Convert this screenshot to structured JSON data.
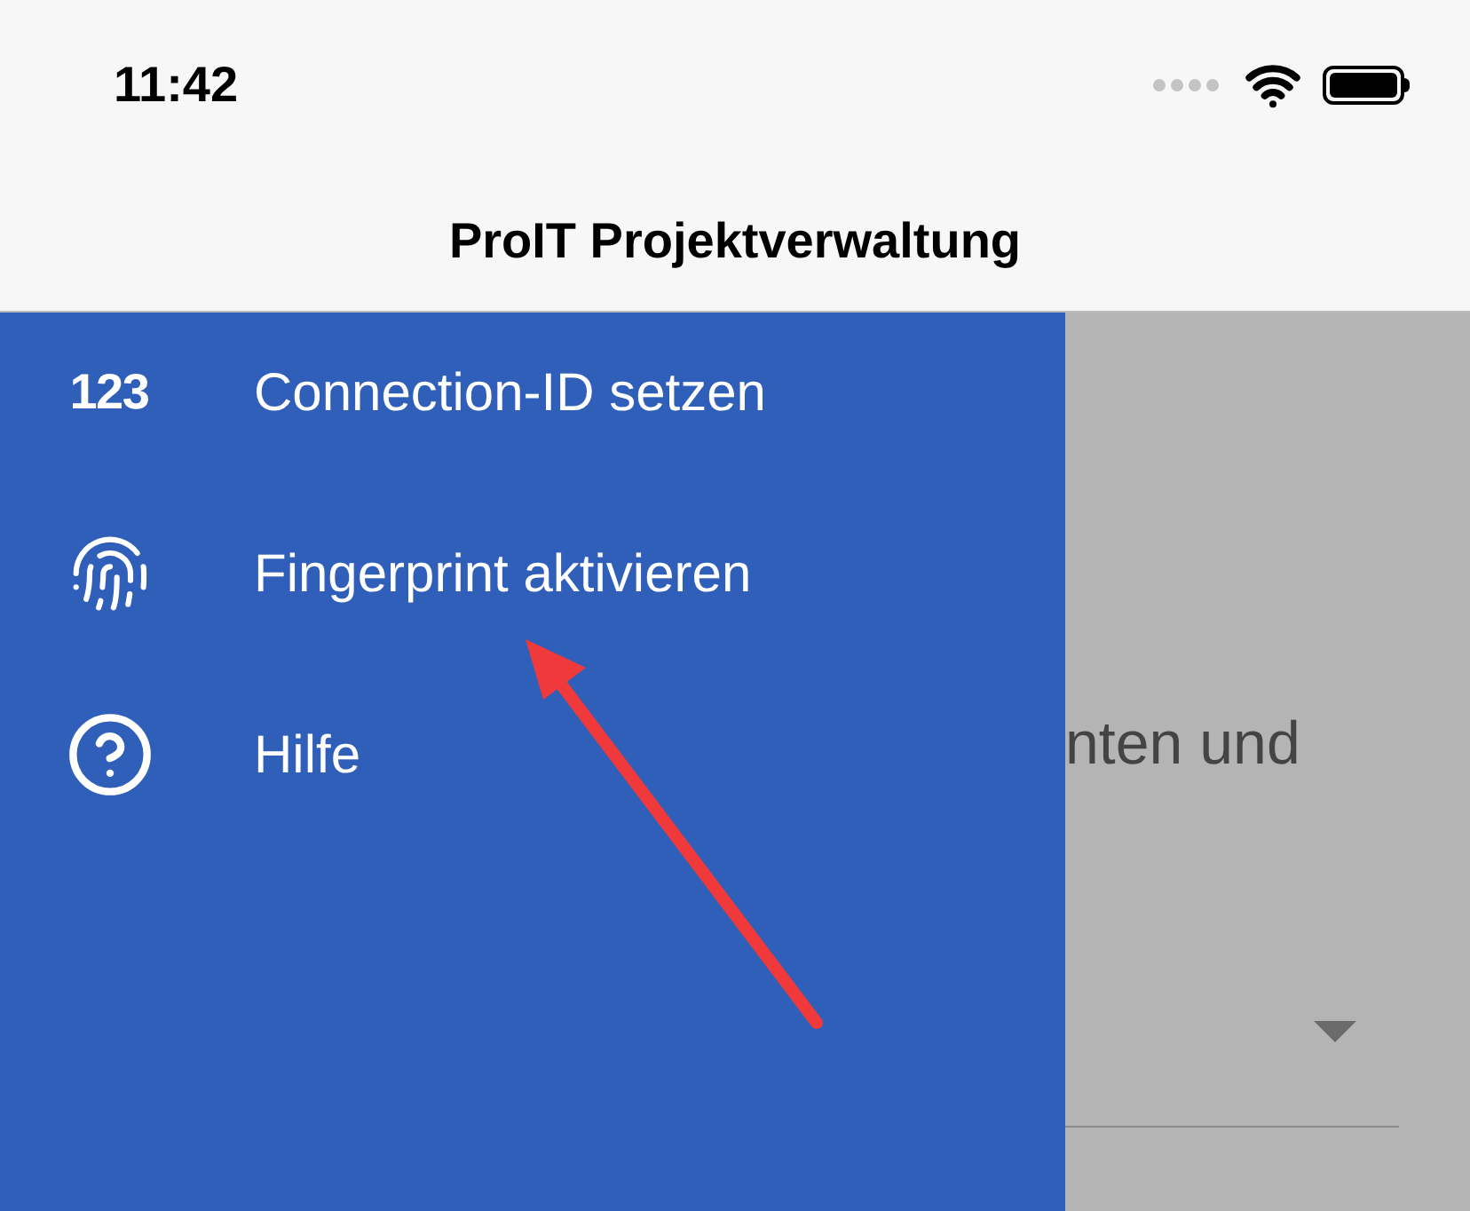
{
  "status_bar": {
    "time": "11:42"
  },
  "header": {
    "title": "ProIT Projektverwaltung"
  },
  "drawer": {
    "items": [
      {
        "kind": "numbers",
        "icon_text": "123",
        "label": "Connection-ID setzen"
      },
      {
        "kind": "fingerprint",
        "label": "Fingerprint aktivieren"
      },
      {
        "kind": "help",
        "label": "Hilfe"
      }
    ]
  },
  "background": {
    "text": "nten und"
  }
}
